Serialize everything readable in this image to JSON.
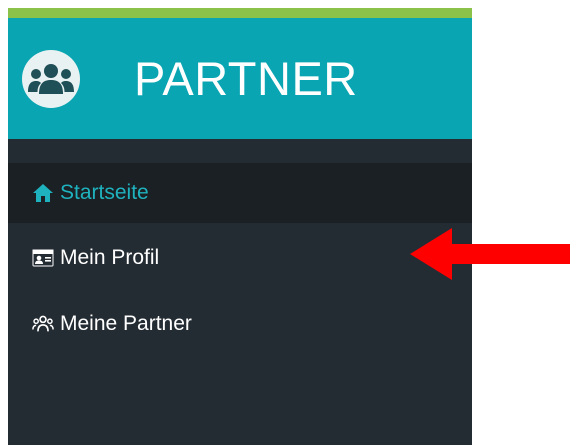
{
  "brand": {
    "title": "PARTNER",
    "logo_icon": "users-group-icon"
  },
  "menu": {
    "items": [
      {
        "label": "Startseite",
        "icon": "home-icon",
        "active": true
      },
      {
        "label": "Mein Profil",
        "icon": "id-card-icon",
        "active": false
      },
      {
        "label": "Meine Partner",
        "icon": "users-icon",
        "active": false
      }
    ]
  },
  "annotation": {
    "arrow_color": "#ff0000",
    "points_to": "Mein Profil"
  },
  "colors": {
    "brand_bg": "#0aa5b2",
    "brand_stripe": "#8bc34a",
    "sidebar_bg": "#232b33",
    "active_item_bg": "#1b2024",
    "active_text": "#1eb2bf"
  }
}
